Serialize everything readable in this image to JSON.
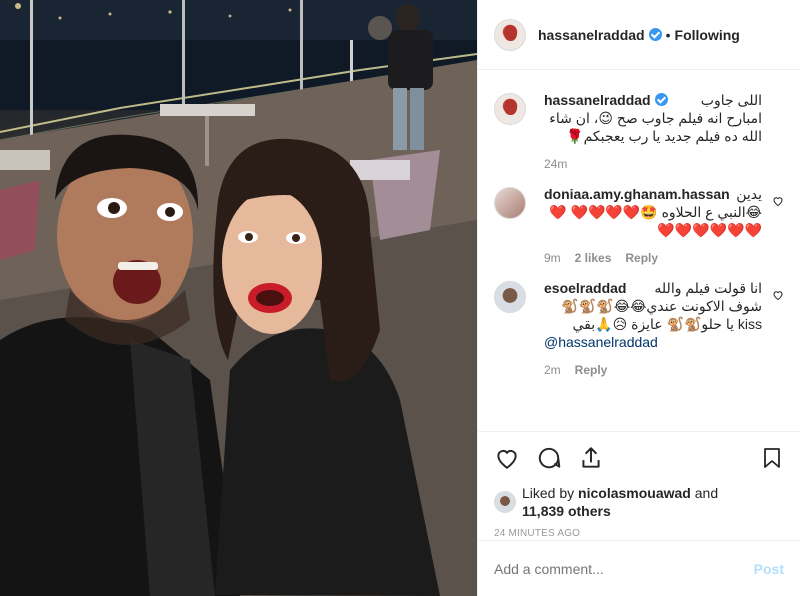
{
  "post": {
    "author": "hassanelraddad",
    "follow_label": "Following",
    "dot": "•"
  },
  "caption": {
    "author": "hassanelraddad",
    "text": "اللى جاوب امبارح انه فيلم جاوب صح 😉، ان شاء الله ده فيلم جديد يا رب يعجبكم🌹",
    "time": "24m"
  },
  "comments": [
    {
      "author": "doniaa.amy.ghanam.hassan",
      "text": "يدين 😂النبي ع الحلاوه 🤩❤️❤️❤️❤️ ❤️❤️❤️❤️❤️❤️❤️",
      "time": "9m",
      "likes": "2 likes",
      "reply": "Reply"
    },
    {
      "author": "esoelraddad",
      "text": "انا قولت فيلم والله شوف الاكونت عندي😂😂🐒🐒🐒 kiss يا حلو🐒🐒 عايزة 😥🙏بقي",
      "mention": "@hassanelraddad",
      "time": "2m",
      "reply": "Reply"
    }
  ],
  "likes": {
    "prefix": "Liked by",
    "user": "nicolasmouawad",
    "conj": "and",
    "others": "11,839 others"
  },
  "timestamp": "24 MINUTES AGO",
  "add_comment": {
    "placeholder": "Add a comment...",
    "post_label": "Post"
  },
  "icons": [
    "heart-icon",
    "comment-icon",
    "share-icon",
    "bookmark-icon",
    "verified-badge-icon"
  ],
  "colors": {
    "verified": "#3897f0",
    "post_disabled": "#b2dffc",
    "heart_emoji": "#e0262b"
  }
}
